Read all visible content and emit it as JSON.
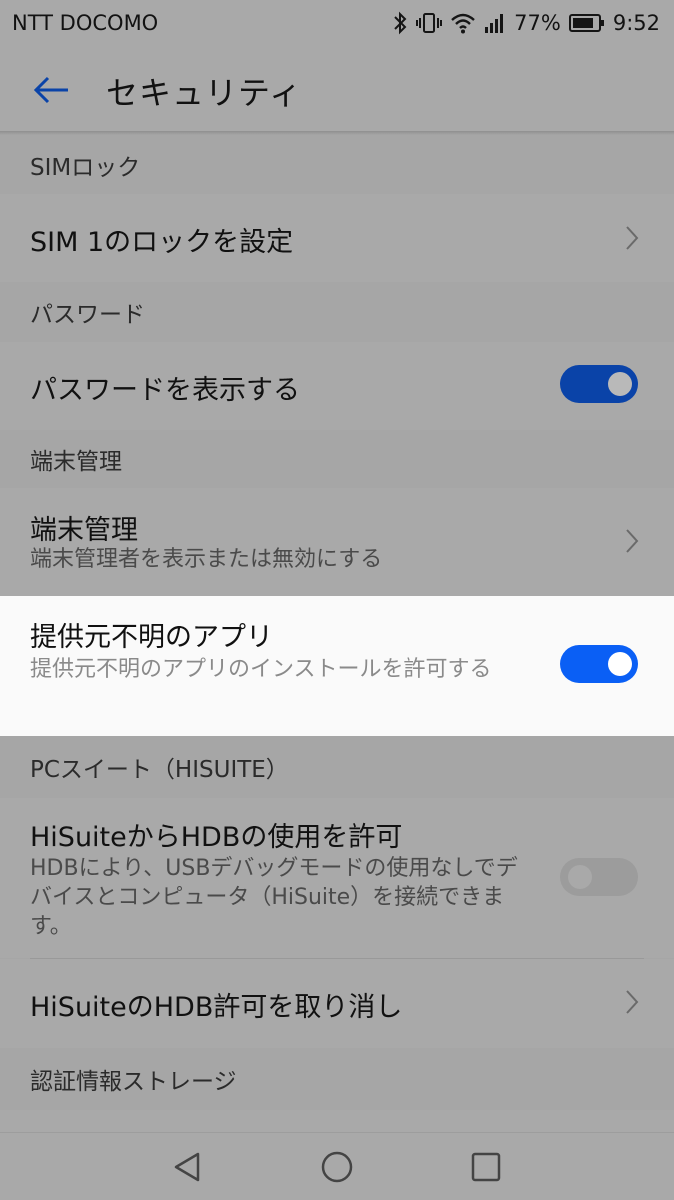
{
  "status_bar": {
    "carrier": "NTT DOCOMO",
    "battery_percent": "77%",
    "time": "9:52",
    "icons": [
      "bluetooth-icon",
      "vibrate-icon",
      "wifi-icon",
      "signal-icon",
      "battery-icon"
    ]
  },
  "app_bar": {
    "title": "セキュリティ",
    "back_icon": "arrow-left-icon"
  },
  "sections": {
    "sim": {
      "header": "SIMロック",
      "item_title": "SIM 1のロックを設定"
    },
    "password": {
      "header": "パスワード",
      "item_title": "パスワードを表示する",
      "toggle_on": true
    },
    "device_admin": {
      "header": "端末管理",
      "item_title": "端末管理",
      "item_subtitle": "端末管理者を表示または無効にする"
    },
    "unknown_sources": {
      "item_title": "提供元不明のアプリ",
      "item_subtitle": "提供元不明のアプリのインストールを許可する",
      "toggle_on": true
    },
    "pc_suite": {
      "header": "PCスイート（HISUITE）",
      "hdb_title": "HiSuiteからHDBの使用を許可",
      "hdb_subtitle": "HDBにより、USBデバッグモードの使用なしでデバイスとコンピュータ（HiSuite）を接続できます。",
      "hdb_toggle_on": false,
      "revoke_title": "HiSuiteのHDB許可を取り消し"
    },
    "credential_storage": {
      "header": "認証情報ストレージ"
    }
  },
  "colors": {
    "accent": "#0a5ff5",
    "accent_dim": "#0a43a8",
    "dim_background": "#a9a9a9",
    "highlight_background": "#fafafa"
  },
  "nav_bar": {
    "icons": [
      "back-triangle-icon",
      "home-circle-icon",
      "recents-square-icon"
    ]
  }
}
